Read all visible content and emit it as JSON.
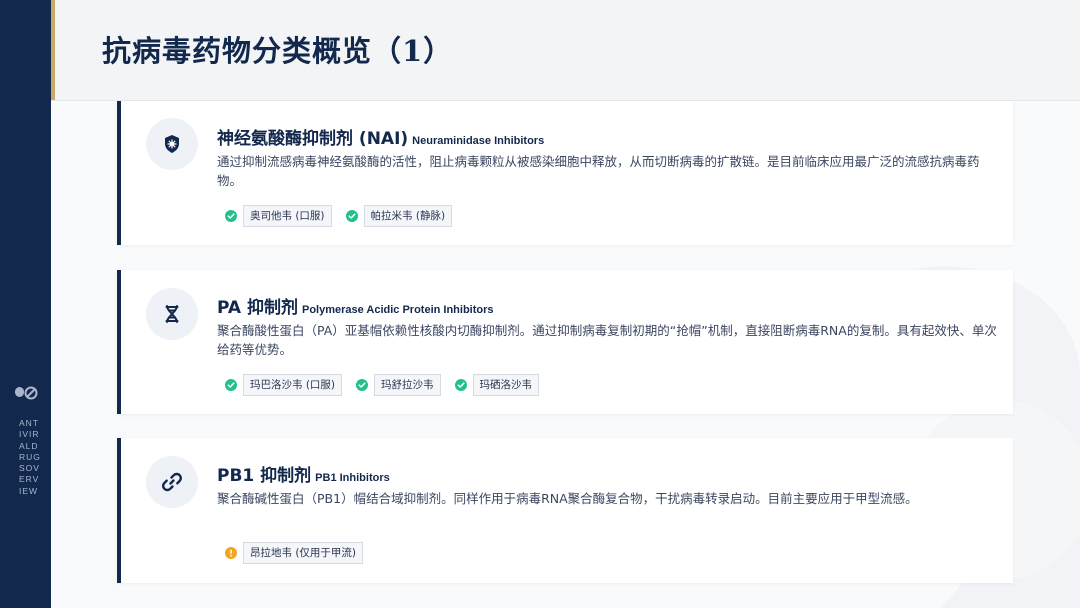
{
  "page": {
    "title": "抗病毒药物分类概览（1）"
  },
  "rail": {
    "vertical_text": "ANTIVIRALDRUGSOVERVIEW",
    "icon": "pill-capsule-icon"
  },
  "colors": {
    "navy": "#13284d",
    "gold_accent": "#c9a968",
    "success_green": "#22c08a",
    "warning_orange": "#f4a51c"
  },
  "cards": [
    {
      "icon": "shield-virus-icon",
      "title": "神经氨酸酶抑制剂 (NAI)",
      "subtitle": "Neuraminidase Inhibitors",
      "description": "通过抑制流感病毒神经氨酸酶的活性，阻止病毒颗粒从被感染细胞中释放，从而切断病毒的扩散链。是目前临床应用最广泛的流感抗病毒药物。",
      "tags": [
        {
          "label": "奥司他韦 (口服)",
          "status": "check"
        },
        {
          "label": "帕拉米韦 (静脉)",
          "status": "check"
        }
      ]
    },
    {
      "icon": "dna-icon",
      "title": "PA 抑制剂",
      "subtitle": "Polymerase Acidic Protein Inhibitors",
      "description": "聚合酶酸性蛋白（PA）亚基帽依赖性核酸内切酶抑制剂。通过抑制病毒复制初期的“抢帽”机制，直接阻断病毒RNA的复制。具有起效快、单次给药等优势。",
      "tags": [
        {
          "label": "玛巴洛沙韦 (口服)",
          "status": "check"
        },
        {
          "label": "玛舒拉沙韦",
          "status": "check"
        },
        {
          "label": "玛硒洛沙韦",
          "status": "check"
        }
      ]
    },
    {
      "icon": "link-icon",
      "title": "PB1 抑制剂",
      "subtitle": "PB1 Inhibitors",
      "description": "聚合酶碱性蛋白（PB1）帽结合域抑制剂。同样作用于病毒RNA聚合酶复合物，干扰病毒转录启动。目前主要应用于甲型流感。",
      "tags": [
        {
          "label": "昂拉地韦 (仅用于甲流)",
          "status": "warning"
        }
      ]
    }
  ]
}
